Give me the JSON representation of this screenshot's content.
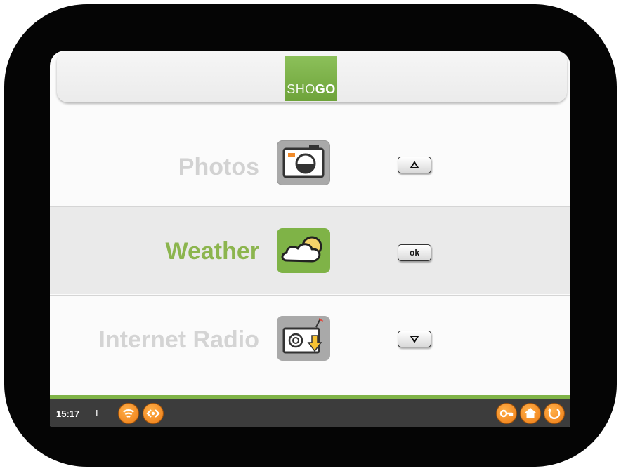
{
  "header": {
    "logo_light": "SHO",
    "logo_bold": "GO"
  },
  "menu": {
    "items": [
      {
        "label": "Photos",
        "icon": "camera-icon",
        "key": "up-arrow-key"
      },
      {
        "label": "Weather",
        "icon": "cloud-sun-icon",
        "key_label": "ok",
        "selected": true
      },
      {
        "label": "Internet Radio",
        "icon": "radio-icon",
        "key": "down-arrow-key"
      }
    ]
  },
  "status": {
    "time": "15:17",
    "separator": "I",
    "left_icons": [
      "wifi-icon",
      "network-icon"
    ],
    "right_icons": [
      "key-icon",
      "home-icon",
      "back-icon"
    ]
  },
  "colors": {
    "accent": "#7fb347",
    "statusbar": "#3c3c3c",
    "status_icon": "#ee7a12",
    "bezel": "#050505"
  }
}
